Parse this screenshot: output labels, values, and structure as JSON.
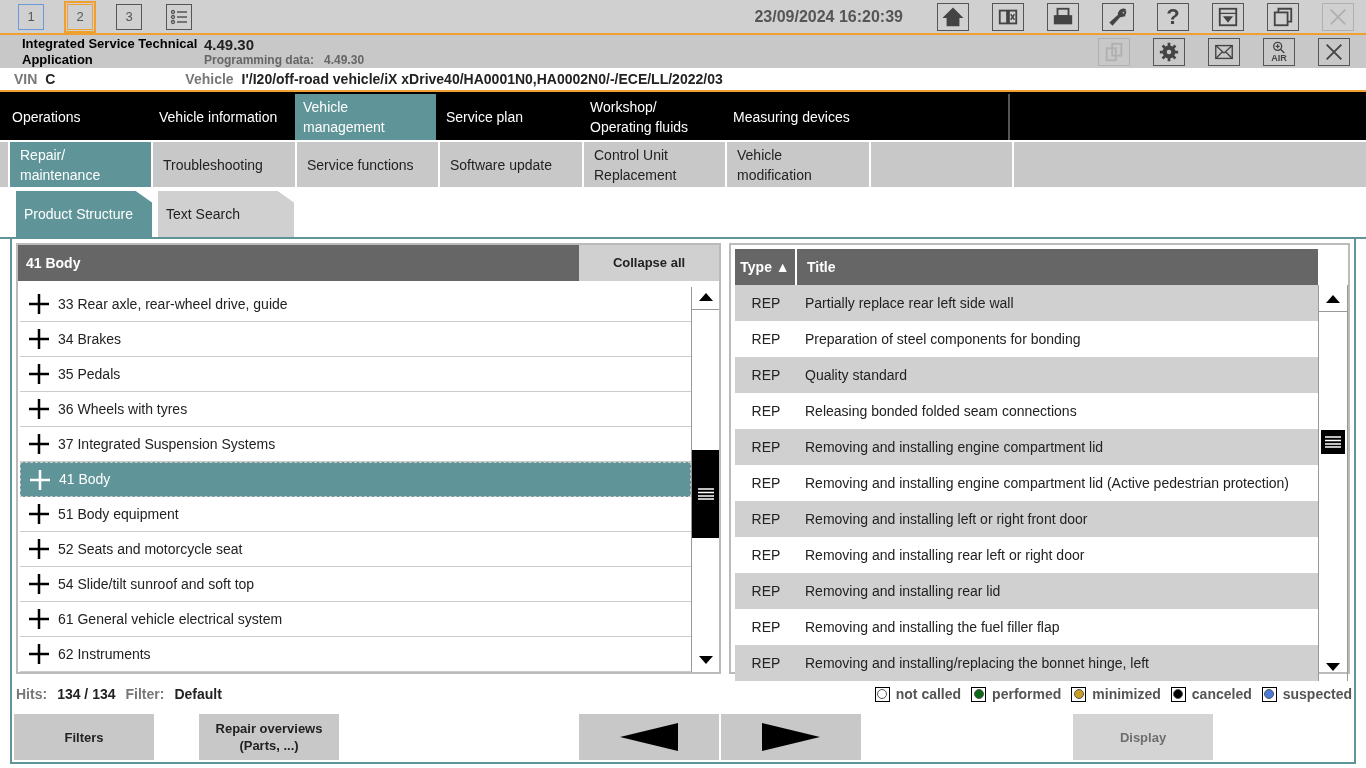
{
  "top_bar": {
    "sessions": [
      {
        "label": "1",
        "selected": false
      },
      {
        "label": "2",
        "selected": true
      },
      {
        "label": "3",
        "selected": false
      }
    ],
    "datetime": "23/09/2024 16:20:39",
    "tools": [
      {
        "kind": "home",
        "disabled": false
      },
      {
        "kind": "split",
        "disabled": false
      },
      {
        "kind": "printer",
        "disabled": false
      },
      {
        "kind": "wrench",
        "disabled": false
      },
      {
        "kind": "help",
        "label": "?",
        "disabled": false
      },
      {
        "kind": "download",
        "disabled": false
      },
      {
        "kind": "windows",
        "disabled": false
      },
      {
        "kind": "close",
        "disabled": true
      }
    ]
  },
  "app_bar": {
    "app_name": "Integrated Service Technical Application",
    "version": "4.49.30",
    "programming_label": "Programming data:",
    "programming_version": "4.49.30",
    "tools": [
      {
        "kind": "documents",
        "disabled": true
      },
      {
        "kind": "gear",
        "disabled": false
      },
      {
        "kind": "mail",
        "disabled": false
      },
      {
        "kind": "air",
        "label": "AIR",
        "disabled": false
      },
      {
        "kind": "close",
        "disabled": false
      }
    ]
  },
  "vehicle_bar": {
    "vin_label": "VIN",
    "vin_value": "C",
    "vehicle_label": "Vehicle",
    "vehicle_value": "I'/I20/off-road vehicle/iX xDrive40/HA0001N0,HA0002N0/-/ECE/LL/2022/03"
  },
  "main_nav": [
    {
      "label": "Operations",
      "selected": false
    },
    {
      "label": "Vehicle information",
      "selected": false
    },
    {
      "label": "Vehicle management",
      "selected": true
    },
    {
      "label": "Service plan",
      "selected": false
    },
    {
      "label": "Workshop/ Operating fluids",
      "selected": false
    },
    {
      "label": "Measuring devices",
      "selected": false
    }
  ],
  "sub_nav": [
    {
      "label": "Repair/ maintenance",
      "selected": true
    },
    {
      "label": "Troubleshooting",
      "selected": false
    },
    {
      "label": "Service functions",
      "selected": false
    },
    {
      "label": "Software update",
      "selected": false
    },
    {
      "label": "Control Unit Replacement",
      "selected": false
    },
    {
      "label": "Vehicle modification",
      "selected": false
    }
  ],
  "tabs": [
    {
      "label": "Product Structure",
      "selected": true
    },
    {
      "label": "Text Search",
      "selected": false
    }
  ],
  "tree": {
    "title": "41 Body",
    "collapse_button": "Collapse all",
    "items": [
      {
        "label": "33 Rear axle, rear-wheel drive, guide",
        "selected": false
      },
      {
        "label": "34 Brakes",
        "selected": false
      },
      {
        "label": "35 Pedals",
        "selected": false
      },
      {
        "label": "36 Wheels with tyres",
        "selected": false
      },
      {
        "label": "37 Integrated Suspension Systems",
        "selected": false
      },
      {
        "label": "41 Body",
        "selected": true
      },
      {
        "label": "51 Body equipment",
        "selected": false
      },
      {
        "label": "52 Seats and motorcycle seat",
        "selected": false
      },
      {
        "label": "54 Slide/tilt sunroof and soft top",
        "selected": false
      },
      {
        "label": "61 General vehicle electrical system",
        "selected": false
      },
      {
        "label": "62 Instruments",
        "selected": false
      }
    ]
  },
  "documents": {
    "columns": [
      "Type ▲",
      "Title"
    ],
    "rows": [
      {
        "type": "REP",
        "title": "Partially replace rear left side wall"
      },
      {
        "type": "REP",
        "title": "Preparation of steel components for bonding"
      },
      {
        "type": "REP",
        "title": "Quality standard"
      },
      {
        "type": "REP",
        "title": "Releasing bonded folded seam connections"
      },
      {
        "type": "REP",
        "title": "Removing and installing engine compartment lid"
      },
      {
        "type": "REP",
        "title": "Removing and installing engine compartment lid (Active pedestrian protection)"
      },
      {
        "type": "REP",
        "title": "Removing and installing left or right front door"
      },
      {
        "type": "REP",
        "title": "Removing and installing rear left or right door"
      },
      {
        "type": "REP",
        "title": "Removing and installing rear lid"
      },
      {
        "type": "REP",
        "title": "Removing and installing the fuel filler flap"
      },
      {
        "type": "REP",
        "title": "Removing and installing/replacing the bonnet hinge, left"
      }
    ]
  },
  "status": {
    "hits_label": "Hits:",
    "hits": "134 / 134",
    "filter_label": "Filter:",
    "filter": "Default"
  },
  "legend": [
    {
      "label": "not called",
      "color": "#ffffff"
    },
    {
      "label": "performed",
      "color": "#0a6b16"
    },
    {
      "label": "minimized",
      "color": "#c8a024"
    },
    {
      "label": "canceled",
      "color": "#000000"
    },
    {
      "label": "suspected",
      "color": "#4a7bd8"
    }
  ],
  "buttons": [
    {
      "kind": "text",
      "label": "Filters",
      "disabled": false
    },
    {
      "kind": "text",
      "label": "Repair overviews (Parts, ...)",
      "disabled": false
    },
    {
      "kind": "back",
      "disabled": false
    },
    {
      "kind": "forward",
      "disabled": false
    },
    {
      "kind": "text",
      "label": "Display",
      "disabled": true
    }
  ]
}
